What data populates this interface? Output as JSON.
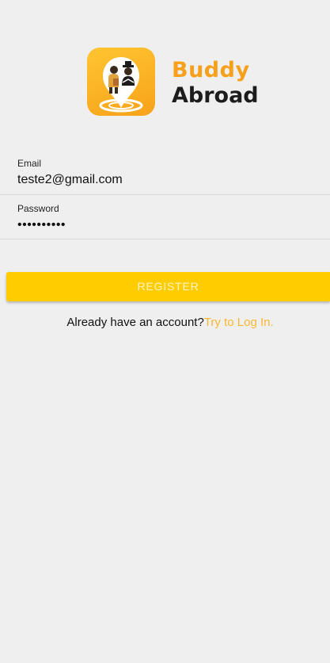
{
  "logo": {
    "line1": "Buddy",
    "line2": "Abroad",
    "icon": "buddy-abroad-location-pin-icon",
    "colors": {
      "tile_top": "#ffc531",
      "tile_bottom": "#f7a21a",
      "accent": "#f7a01c"
    }
  },
  "form": {
    "email": {
      "label": "Email",
      "value": "teste2@gmail.com"
    },
    "password": {
      "label": "Password",
      "value": "••••••••••"
    }
  },
  "register": {
    "label": "REGISTER",
    "color": "#ffcc00"
  },
  "login_prompt": {
    "text": "Already have an account?",
    "link": "Try to Log In.",
    "link_color": "#f7b733"
  }
}
